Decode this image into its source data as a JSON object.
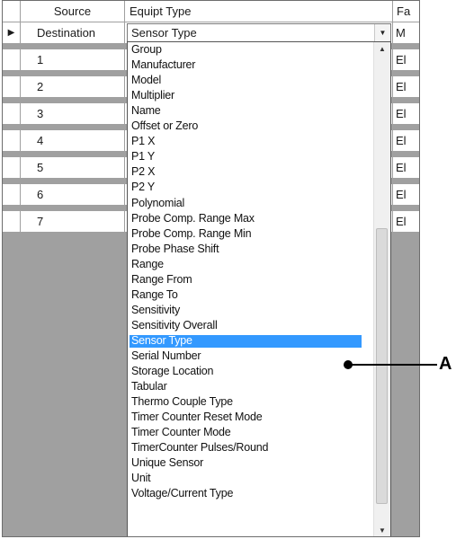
{
  "grid": {
    "headers": {
      "source": "Source",
      "equipt_type": "Equipt Type",
      "fa": "Fa"
    },
    "rows": [
      {
        "marker": "▶",
        "label": "Destination",
        "fa": "M"
      },
      {
        "marker": "",
        "label": "1",
        "fa": "El"
      },
      {
        "marker": "",
        "label": "2",
        "fa": "El"
      },
      {
        "marker": "",
        "label": "3",
        "fa": "El"
      },
      {
        "marker": "",
        "label": "4",
        "fa": "El"
      },
      {
        "marker": "",
        "label": "5",
        "fa": "El"
      },
      {
        "marker": "",
        "label": "6",
        "fa": "El"
      },
      {
        "marker": "",
        "label": "7",
        "fa": "El"
      }
    ]
  },
  "combo": {
    "value": "Sensor Type"
  },
  "dropdown": {
    "items": [
      "Group",
      "Manufacturer",
      "Model",
      "Multiplier",
      "Name",
      "Offset or Zero",
      "P1 X",
      "P1 Y",
      "P2 X",
      "P2 Y",
      "Polynomial",
      "Probe Comp. Range Max",
      "Probe Comp. Range Min",
      "Probe Phase Shift",
      "Range",
      "Range From",
      "Range To",
      "Sensitivity",
      "Sensitivity Overall",
      "Sensor Type",
      "Serial Number",
      "Storage Location",
      "Tabular",
      "Thermo Couple Type",
      "Timer Counter  Reset Mode",
      "Timer Counter Mode",
      "TimerCounter Pulses/Round",
      "Unique Sensor",
      "Unit",
      "Voltage/Current Type"
    ],
    "selected": "Sensor Type",
    "selection_color": "#3399ff"
  },
  "callout": {
    "label": "A"
  }
}
